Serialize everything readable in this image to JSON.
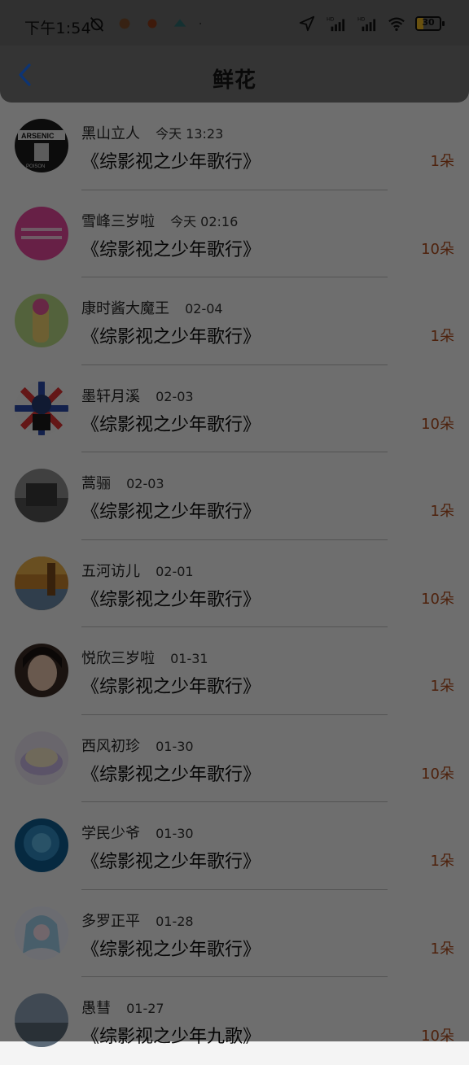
{
  "status_bar": {
    "time": "下午1:54",
    "battery": "30",
    "battery_level": 0.3,
    "icons_left": [
      "alarm-off-icon",
      "app-notification-icon",
      "app-notification-icon",
      "app-notification-icon",
      "dot-icon"
    ],
    "icons_right": [
      "location-icon",
      "hd-signal-icon",
      "hd-signal-icon",
      "wifi-icon",
      "battery-icon"
    ]
  },
  "header": {
    "title": "鲜花",
    "back_icon": "chevron-left-icon"
  },
  "colors": {
    "accent": "#1e73ff",
    "count": "#ad4b1c"
  },
  "items": [
    {
      "user": "黑山立人",
      "time": "今天 13:23",
      "book": "《综影视之少年歌行》",
      "count": "1朵"
    },
    {
      "user": "雪峰三岁啦",
      "time": "今天 02:16",
      "book": "《综影视之少年歌行》",
      "count": "10朵"
    },
    {
      "user": "康时酱大魔王",
      "time": "02-04",
      "book": "《综影视之少年歌行》",
      "count": "1朵"
    },
    {
      "user": "墨轩月溪",
      "time": "02-03",
      "book": "《综影视之少年歌行》",
      "count": "10朵"
    },
    {
      "user": "蒿骊",
      "time": "02-03",
      "book": "《综影视之少年歌行》",
      "count": "1朵"
    },
    {
      "user": "五河访儿",
      "time": "02-01",
      "book": "《综影视之少年歌行》",
      "count": "10朵"
    },
    {
      "user": "悦欣三岁啦",
      "time": "01-31",
      "book": "《综影视之少年歌行》",
      "count": "1朵"
    },
    {
      "user": "西风初珍",
      "time": "01-30",
      "book": "《综影视之少年歌行》",
      "count": "10朵"
    },
    {
      "user": "学民少爷",
      "time": "01-30",
      "book": "《综影视之少年歌行》",
      "count": "1朵"
    },
    {
      "user": "多罗正平",
      "time": "01-28",
      "book": "《综影视之少年歌行》",
      "count": "1朵"
    },
    {
      "user": "愚彗",
      "time": "01-27",
      "book": "《综影视之少年九歌》",
      "count": "10朵"
    }
  ]
}
